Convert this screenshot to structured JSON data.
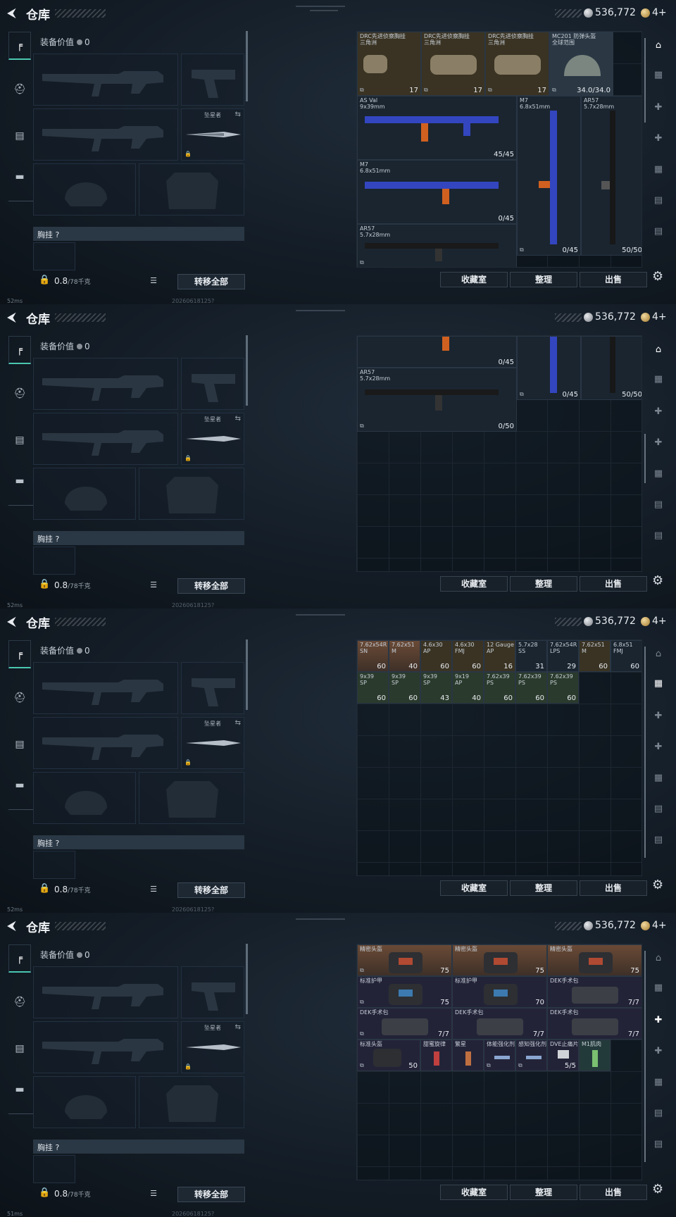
{
  "header": {
    "title": "仓库",
    "currency": "536,772",
    "tickets": "4+"
  },
  "left_nav": {
    "tabs": [
      "weapon-icon",
      "helmet-icon",
      "armor-icon",
      "bag-icon"
    ]
  },
  "equipment": {
    "value_label": "装备价值",
    "value": "0",
    "melee_label": "坠星者",
    "chest_label": "胸挂",
    "chest_hint": "?",
    "weight": "0.8",
    "weight_unit": "/78千克",
    "transfer_all": "转移全部"
  },
  "bottom": {
    "collection": "收藏室",
    "sort": "整理",
    "sell": "出售"
  },
  "status": [
    {
      "ping": "52ms",
      "build": "20260618125?"
    },
    {
      "ping": "52ms",
      "build": "20260618125?"
    },
    {
      "ping": "52ms",
      "build": "20260618125?"
    },
    {
      "ping": "51ms",
      "build": "20260618125?"
    }
  ],
  "panel1_items": [
    {
      "name": "DRC先进侦察胸挂",
      "sub": "三角洲",
      "qty": "17"
    },
    {
      "name": "DRC先进侦察胸挂",
      "sub": "三角洲",
      "qty": "17"
    },
    {
      "name": "DRC先进侦察胸挂",
      "sub": "三角洲",
      "qty": "17"
    },
    {
      "name": "MC201 防弹头盔",
      "sub": "全球范围",
      "qty": "34.0/34.0"
    },
    {
      "name": "AS Val",
      "sub": "9x39mm",
      "qty": "45/45"
    },
    {
      "name": "M7",
      "sub": "6.8x51mm",
      "qty": "0/45"
    },
    {
      "name": "AR57",
      "sub": "5.7x28mm",
      "qty": "50/50"
    },
    {
      "name": "M7",
      "sub": "6.8x51mm",
      "qty": "0/45"
    },
    {
      "name": "AR57",
      "sub": "5.7x28mm",
      "qty": ""
    }
  ],
  "panel2_items": [
    {
      "name": "",
      "sub": "",
      "qty": "0/45"
    },
    {
      "name": "",
      "sub": "",
      "qty": "0/45"
    },
    {
      "name": "",
      "sub": "",
      "qty": "50/50"
    },
    {
      "name": "AR57",
      "sub": "5.7x28mm",
      "qty": "0/50"
    }
  ],
  "panel3_items": [
    {
      "name": "7.62x54R",
      "sub": "SN",
      "qty": "60"
    },
    {
      "name": "7.62x51",
      "sub": "M",
      "qty": "40"
    },
    {
      "name": "4.6x30",
      "sub": "AP",
      "qty": "60"
    },
    {
      "name": "4.6x30",
      "sub": "FMJ",
      "qty": "60"
    },
    {
      "name": "12 Gauge",
      "sub": "AP",
      "qty": "16"
    },
    {
      "name": "5.7x28",
      "sub": "SS",
      "qty": "31"
    },
    {
      "name": "7.62x54R",
      "sub": "LPS",
      "qty": "29"
    },
    {
      "name": "7.62x51",
      "sub": "M",
      "qty": "60"
    },
    {
      "name": "6.8x51",
      "sub": "FMJ",
      "qty": "60"
    },
    {
      "name": "9x39",
      "sub": "SP",
      "qty": "60"
    },
    {
      "name": "9x39",
      "sub": "SP",
      "qty": "60"
    },
    {
      "name": "9x39",
      "sub": "SP",
      "qty": "43"
    },
    {
      "name": "9x19",
      "sub": "AP",
      "qty": "40"
    },
    {
      "name": "7.62x39",
      "sub": "PS",
      "qty": "60"
    },
    {
      "name": "7.62x39",
      "sub": "PS",
      "qty": "60"
    },
    {
      "name": "7.62x39",
      "sub": "PS",
      "qty": "60"
    }
  ],
  "panel4_items": [
    {
      "name": "精密头盔",
      "qty": "75"
    },
    {
      "name": "精密头盔",
      "qty": "75"
    },
    {
      "name": "精密头盔",
      "qty": "75"
    },
    {
      "name": "标准护甲",
      "qty": "75"
    },
    {
      "name": "标准护甲",
      "qty": "70"
    },
    {
      "name": "DEK手术包",
      "qty": "7/7"
    },
    {
      "name": "DEK手术包",
      "qty": "7/7"
    },
    {
      "name": "DEK手术包",
      "qty": "7/7"
    },
    {
      "name": "DEK手术包",
      "qty": "7/7"
    },
    {
      "name": "标准头盔",
      "qty": "50"
    },
    {
      "name": "甜蜜旋律",
      "qty": ""
    },
    {
      "name": "繁星",
      "qty": ""
    },
    {
      "name": "体能强化剂",
      "qty": ""
    },
    {
      "name": "感知强化剂",
      "qty": ""
    },
    {
      "name": "DVE止痛片",
      "qty": "5/5"
    },
    {
      "name": "M1肌肉",
      "qty": ""
    }
  ]
}
